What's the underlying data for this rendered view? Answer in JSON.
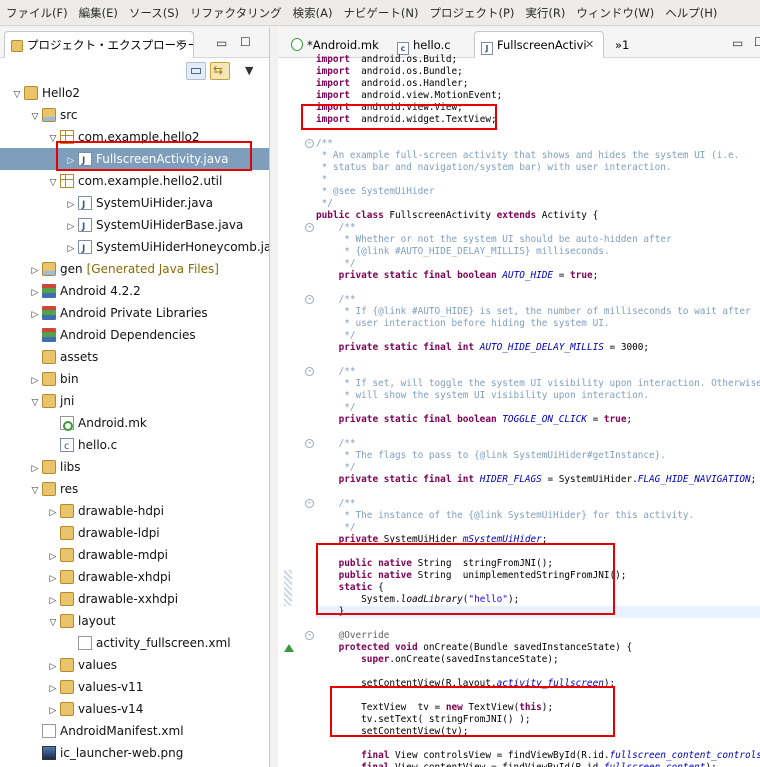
{
  "menubar": [
    "ファイル(F)",
    "編集(E)",
    "ソース(S)",
    "リファクタリング",
    "検索(A)",
    "ナビゲート(N)",
    "プロジェクト(P)",
    "実行(R)",
    "ウィンドウ(W)",
    "ヘルプ(H)"
  ],
  "explorer": {
    "title": "プロジェクト・エクスプローラー",
    "tree": [
      {
        "label": "Hello2",
        "icon": "project-icon",
        "arrow": "expanded"
      },
      {
        "label": "src",
        "icon": "source-folder-icon",
        "arrow": "expanded"
      },
      {
        "label": "com.example.hello2",
        "icon": "package-icon",
        "arrow": "expanded"
      },
      {
        "label": "FullscreenActivity.java",
        "icon": "java-file-icon",
        "arrow": "collapsed",
        "selected": true
      },
      {
        "label": "com.example.hello2.util",
        "icon": "package-icon",
        "arrow": "expanded"
      },
      {
        "label": "SystemUiHider.java",
        "icon": "java-file-icon",
        "arrow": "collapsed"
      },
      {
        "label": "SystemUiHiderBase.java",
        "icon": "java-file-icon",
        "arrow": "collapsed"
      },
      {
        "label": "SystemUiHiderHoneycomb.java",
        "icon": "java-file-icon",
        "arrow": "collapsed"
      },
      {
        "label": "gen",
        "decoration": "[Generated Java Files]",
        "icon": "source-folder-icon",
        "arrow": "collapsed"
      },
      {
        "label": "Android 4.2.2",
        "icon": "library-icon",
        "arrow": "collapsed"
      },
      {
        "label": "Android Private Libraries",
        "icon": "library-icon",
        "arrow": "collapsed"
      },
      {
        "label": "Android Dependencies",
        "icon": "library-icon",
        "arrow": "none"
      },
      {
        "label": "assets",
        "icon": "folder-icon",
        "arrow": "none"
      },
      {
        "label": "bin",
        "icon": "folder-icon",
        "arrow": "collapsed"
      },
      {
        "label": "jni",
        "icon": "folder-icon",
        "arrow": "expanded"
      },
      {
        "label": "Android.mk",
        "icon": "makefile-icon",
        "arrow": "none"
      },
      {
        "label": "hello.c",
        "icon": "c-file-icon",
        "arrow": "none"
      },
      {
        "label": "libs",
        "icon": "folder-icon",
        "arrow": "collapsed"
      },
      {
        "label": "res",
        "icon": "folder-icon",
        "arrow": "expanded"
      },
      {
        "label": "drawable-hdpi",
        "icon": "folder-icon",
        "arrow": "collapsed"
      },
      {
        "label": "drawable-ldpi",
        "icon": "folder-icon",
        "arrow": "none"
      },
      {
        "label": "drawable-mdpi",
        "icon": "folder-icon",
        "arrow": "collapsed"
      },
      {
        "label": "drawable-xhdpi",
        "icon": "folder-icon",
        "arrow": "collapsed"
      },
      {
        "label": "drawable-xxhdpi",
        "icon": "folder-icon",
        "arrow": "collapsed"
      },
      {
        "label": "layout",
        "icon": "folder-icon",
        "arrow": "expanded"
      },
      {
        "label": "activity_fullscreen.xml",
        "icon": "xml-file-icon",
        "arrow": "none"
      },
      {
        "label": "values",
        "icon": "folder-icon",
        "arrow": "collapsed"
      },
      {
        "label": "values-v11",
        "icon": "folder-icon",
        "arrow": "collapsed"
      },
      {
        "label": "values-v14",
        "icon": "folder-icon",
        "arrow": "collapsed"
      },
      {
        "label": "AndroidManifest.xml",
        "icon": "manifest-icon",
        "arrow": "none"
      },
      {
        "label": "ic_launcher-web.png",
        "icon": "image-file-icon",
        "arrow": "none"
      }
    ]
  },
  "editor": {
    "tabs": [
      {
        "label": "*Android.mk",
        "icon": "makefile-icon"
      },
      {
        "label": "hello.c",
        "icon": "c-file-icon"
      },
      {
        "label": "FullscreenActivi",
        "icon": "java-file-icon",
        "active": true
      },
      {
        "label": "»1",
        "icon": "overflow-icon"
      }
    ],
    "lines": [
      [
        [
          "kw",
          "import"
        ],
        [
          "",
          "  android.os.Build;"
        ]
      ],
      [
        [
          "kw",
          "import"
        ],
        [
          "",
          "  android.os.Bundle;"
        ]
      ],
      [
        [
          "kw",
          "import"
        ],
        [
          "",
          "  android.os.Handler;"
        ]
      ],
      [
        [
          "kw",
          "import"
        ],
        [
          "",
          "  android.view.MotionEvent;"
        ]
      ],
      [
        [
          "kw",
          "import"
        ],
        [
          "",
          "  android.view.View;"
        ]
      ],
      [
        [
          "kw",
          "import"
        ],
        [
          "",
          "  android.widget.TextView;"
        ]
      ],
      [],
      [
        [
          "jd",
          "/**"
        ]
      ],
      [
        [
          "jd",
          " * An example full-screen activity that shows and hides the system UI (i.e."
        ]
      ],
      [
        [
          "jd",
          " * status bar and navigation/system bar) with user interaction."
        ]
      ],
      [
        [
          "jd",
          " *"
        ]
      ],
      [
        [
          "jd",
          " * @see SystemUiHider"
        ]
      ],
      [
        [
          "jd",
          " */"
        ]
      ],
      [
        [
          "kw",
          "public class"
        ],
        [
          "",
          " FullscreenActivity "
        ],
        [
          "kw",
          "extends"
        ],
        [
          "",
          " Activity {"
        ]
      ],
      [
        [
          "jd",
          "    /**"
        ]
      ],
      [
        [
          "jd",
          "     * Whether or not the system UI should be auto-hidden after"
        ]
      ],
      [
        [
          "jd",
          "     * {@link #AUTO_HIDE_DELAY_MILLIS} milliseconds."
        ]
      ],
      [
        [
          "jd",
          "     */"
        ]
      ],
      [
        [
          "kw",
          "    private static final boolean"
        ],
        [
          "",
          " "
        ],
        [
          "sfld",
          "AUTO_HIDE"
        ],
        [
          "",
          " = "
        ],
        [
          "kw",
          "true"
        ],
        [
          "",
          ";"
        ]
      ],
      [],
      [
        [
          "jd",
          "    /**"
        ]
      ],
      [
        [
          "jd",
          "     * If {@link #AUTO_HIDE} is set, the number of milliseconds to wait after"
        ]
      ],
      [
        [
          "jd",
          "     * user interaction before hiding the system UI."
        ]
      ],
      [
        [
          "jd",
          "     */"
        ]
      ],
      [
        [
          "kw",
          "    private static final int"
        ],
        [
          "",
          " "
        ],
        [
          "sfld",
          "AUTO_HIDE_DELAY_MILLIS"
        ],
        [
          "",
          " = 3000;"
        ]
      ],
      [],
      [
        [
          "jd",
          "    /**"
        ]
      ],
      [
        [
          "jd",
          "     * If set, will toggle the system UI visibility upon interaction. Otherwise,"
        ]
      ],
      [
        [
          "jd",
          "     * will show the system UI visibility upon interaction."
        ]
      ],
      [
        [
          "jd",
          "     */"
        ]
      ],
      [
        [
          "kw",
          "    private static final boolean"
        ],
        [
          "",
          " "
        ],
        [
          "sfld",
          "TOGGLE_ON_CLICK"
        ],
        [
          "",
          " = "
        ],
        [
          "kw",
          "true"
        ],
        [
          "",
          ";"
        ]
      ],
      [],
      [
        [
          "jd",
          "    /**"
        ]
      ],
      [
        [
          "jd",
          "     * The flags to pass to {@link SystemUiHider#getInstance}."
        ]
      ],
      [
        [
          "jd",
          "     */"
        ]
      ],
      [
        [
          "kw",
          "    private static final int"
        ],
        [
          "",
          " "
        ],
        [
          "sfld",
          "HIDER_FLAGS"
        ],
        [
          "",
          " = SystemUiHider."
        ],
        [
          "sfld",
          "FLAG_HIDE_NAVIGATION"
        ],
        [
          "",
          ";"
        ]
      ],
      [],
      [
        [
          "jd",
          "    /**"
        ]
      ],
      [
        [
          "jd",
          "     * The instance of the {@link SystemUiHider} for this activity."
        ]
      ],
      [
        [
          "jd",
          "     */"
        ]
      ],
      [
        [
          "kw",
          "    private"
        ],
        [
          "",
          " SystemUiHider "
        ],
        [
          "fld",
          "mSystemUiHider"
        ],
        [
          "",
          ";"
        ]
      ],
      [],
      [
        [
          "kw",
          "    public native"
        ],
        [
          "",
          " String  stringFromJNI();"
        ]
      ],
      [
        [
          "kw",
          "    public native"
        ],
        [
          "",
          " String  unimplementedStringFromJNI();"
        ]
      ],
      [
        [
          "kw",
          "    static"
        ],
        [
          "",
          " {"
        ]
      ],
      [
        [
          "",
          "        System."
        ],
        [
          "mth",
          "loadLibrary"
        ],
        [
          "",
          "("
        ],
        [
          "str",
          "\"hello\""
        ],
        [
          "",
          ");"
        ]
      ],
      [
        [
          "",
          "    }"
        ]
      ],
      [],
      [
        [
          "ann",
          "    @Override"
        ]
      ],
      [
        [
          "kw",
          "    protected void"
        ],
        [
          "",
          " onCreate(Bundle savedInstanceState) {"
        ]
      ],
      [
        [
          "kw",
          "        super"
        ],
        [
          "",
          ".onCreate(savedInstanceState);"
        ]
      ],
      [],
      [
        [
          "",
          "        setContentView(R.layout."
        ],
        [
          "sfld",
          "activity_fullscreen"
        ],
        [
          "",
          ");"
        ]
      ],
      [],
      [
        [
          "",
          "        TextView  tv = "
        ],
        [
          "kw",
          "new"
        ],
        [
          "",
          " TextView("
        ],
        [
          "kw",
          "this"
        ],
        [
          "",
          ");"
        ]
      ],
      [
        [
          "",
          "        tv.setText( stringFromJNI() );"
        ]
      ],
      [
        [
          "",
          "        setContentView(tv);"
        ]
      ],
      [],
      [
        [
          "kw",
          "        final"
        ],
        [
          "",
          " View controlsView = findViewById(R.id."
        ],
        [
          "sfld",
          "fullscreen_content_controls"
        ],
        [
          "",
          ");"
        ]
      ],
      [
        [
          "kw",
          "        final"
        ],
        [
          "",
          " View contentView = findViewById(R.id."
        ],
        [
          "sfld",
          "fullscreen_content"
        ],
        [
          "",
          ");"
        ]
      ]
    ]
  },
  "colors": {
    "highlight_box": "#e60000",
    "selection": "#7f9ebb",
    "keyword": "#7f0055",
    "javadoc": "#7f9fbf",
    "field": "#0000c0",
    "string": "#2a00ff"
  }
}
